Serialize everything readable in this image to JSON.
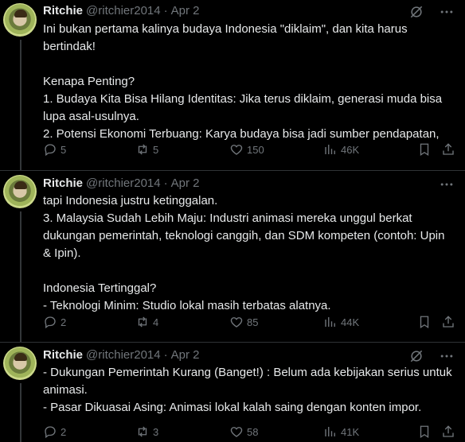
{
  "tweets": [
    {
      "name": "Ritchie",
      "handle": "@ritchier2014",
      "dot": "·",
      "date": "Apr 2",
      "text": "Ini bukan pertama kalinya budaya Indonesia \"diklaim\", dan kita harus bertindak!\n\nKenapa Penting?\n1. Budaya Kita Bisa Hilang Identitas: Jika terus diklaim, generasi muda bisa lupa asal-usulnya.\n2. Potensi Ekonomi Terbuang: Karya budaya bisa jadi sumber pendapatan,",
      "replies": "5",
      "reposts": "5",
      "likes": "150",
      "views": "46K"
    },
    {
      "name": "Ritchie",
      "handle": "@ritchier2014",
      "dot": "·",
      "date": "Apr 2",
      "text": "tapi Indonesia justru ketinggalan.\n3. Malaysia Sudah Lebih Maju: Industri animasi mereka unggul berkat dukungan pemerintah, teknologi canggih, dan SDM kompeten (contoh: Upin & Ipin).\n\nIndonesia Tertinggal?\n- Teknologi Minim: Studio lokal masih terbatas alatnya.",
      "replies": "2",
      "reposts": "4",
      "likes": "85",
      "views": "44K"
    },
    {
      "name": "Ritchie",
      "handle": "@ritchier2014",
      "dot": "·",
      "date": "Apr 2",
      "text": "- Dukungan Pemerintah Kurang (Banget!) : Belum ada kebijakan serius untuk animasi.\n- Pasar Dikuasai Asing: Animasi lokal kalah saing dengan konten impor.",
      "replies": "2",
      "reposts": "3",
      "likes": "58",
      "views": "41K"
    }
  ],
  "icons": {
    "grok": "grok-icon",
    "more": "more-icon",
    "reply": "reply-icon",
    "repost": "repost-icon",
    "like": "like-icon",
    "views": "views-icon",
    "bookmark": "bookmark-icon",
    "share": "share-icon"
  },
  "colors": {
    "background": "#000000",
    "text": "#e7e9ea",
    "muted": "#71767b",
    "divider": "#2f3336"
  }
}
